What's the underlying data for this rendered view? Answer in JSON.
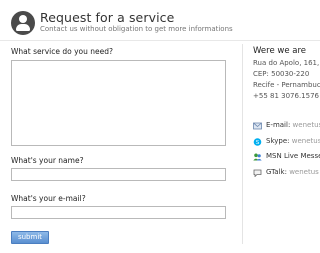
{
  "header": {
    "title": "Request for a service",
    "subtitle": "Contact us without obligation to get more informations"
  },
  "form": {
    "service_label": "What service do you need?",
    "service_value": "",
    "name_label": "What's your name?",
    "name_value": "",
    "email_label": "What's your e-mail?",
    "email_value": "",
    "submit_label": "submit"
  },
  "sidebar": {
    "title": "Were we are",
    "address": [
      "Rua do Apolo, 161,",
      "CEP: 50030-220",
      "Recife - Pernambuc",
      "+55 81 3076.1576"
    ],
    "contacts": [
      {
        "label": "E-mail:",
        "value": "wenetus",
        "icon": "email-icon"
      },
      {
        "label": "Skype:",
        "value": "wenetus",
        "icon": "skype-icon"
      },
      {
        "label": "MSN Live Messe",
        "value": "",
        "icon": "msn-icon"
      },
      {
        "label": "GTalk:",
        "value": "wenetus",
        "icon": "gtalk-icon"
      }
    ]
  },
  "colors": {
    "accent": "#5a8fd0",
    "skype": "#00aff0",
    "msn": "#3c9a3c"
  }
}
